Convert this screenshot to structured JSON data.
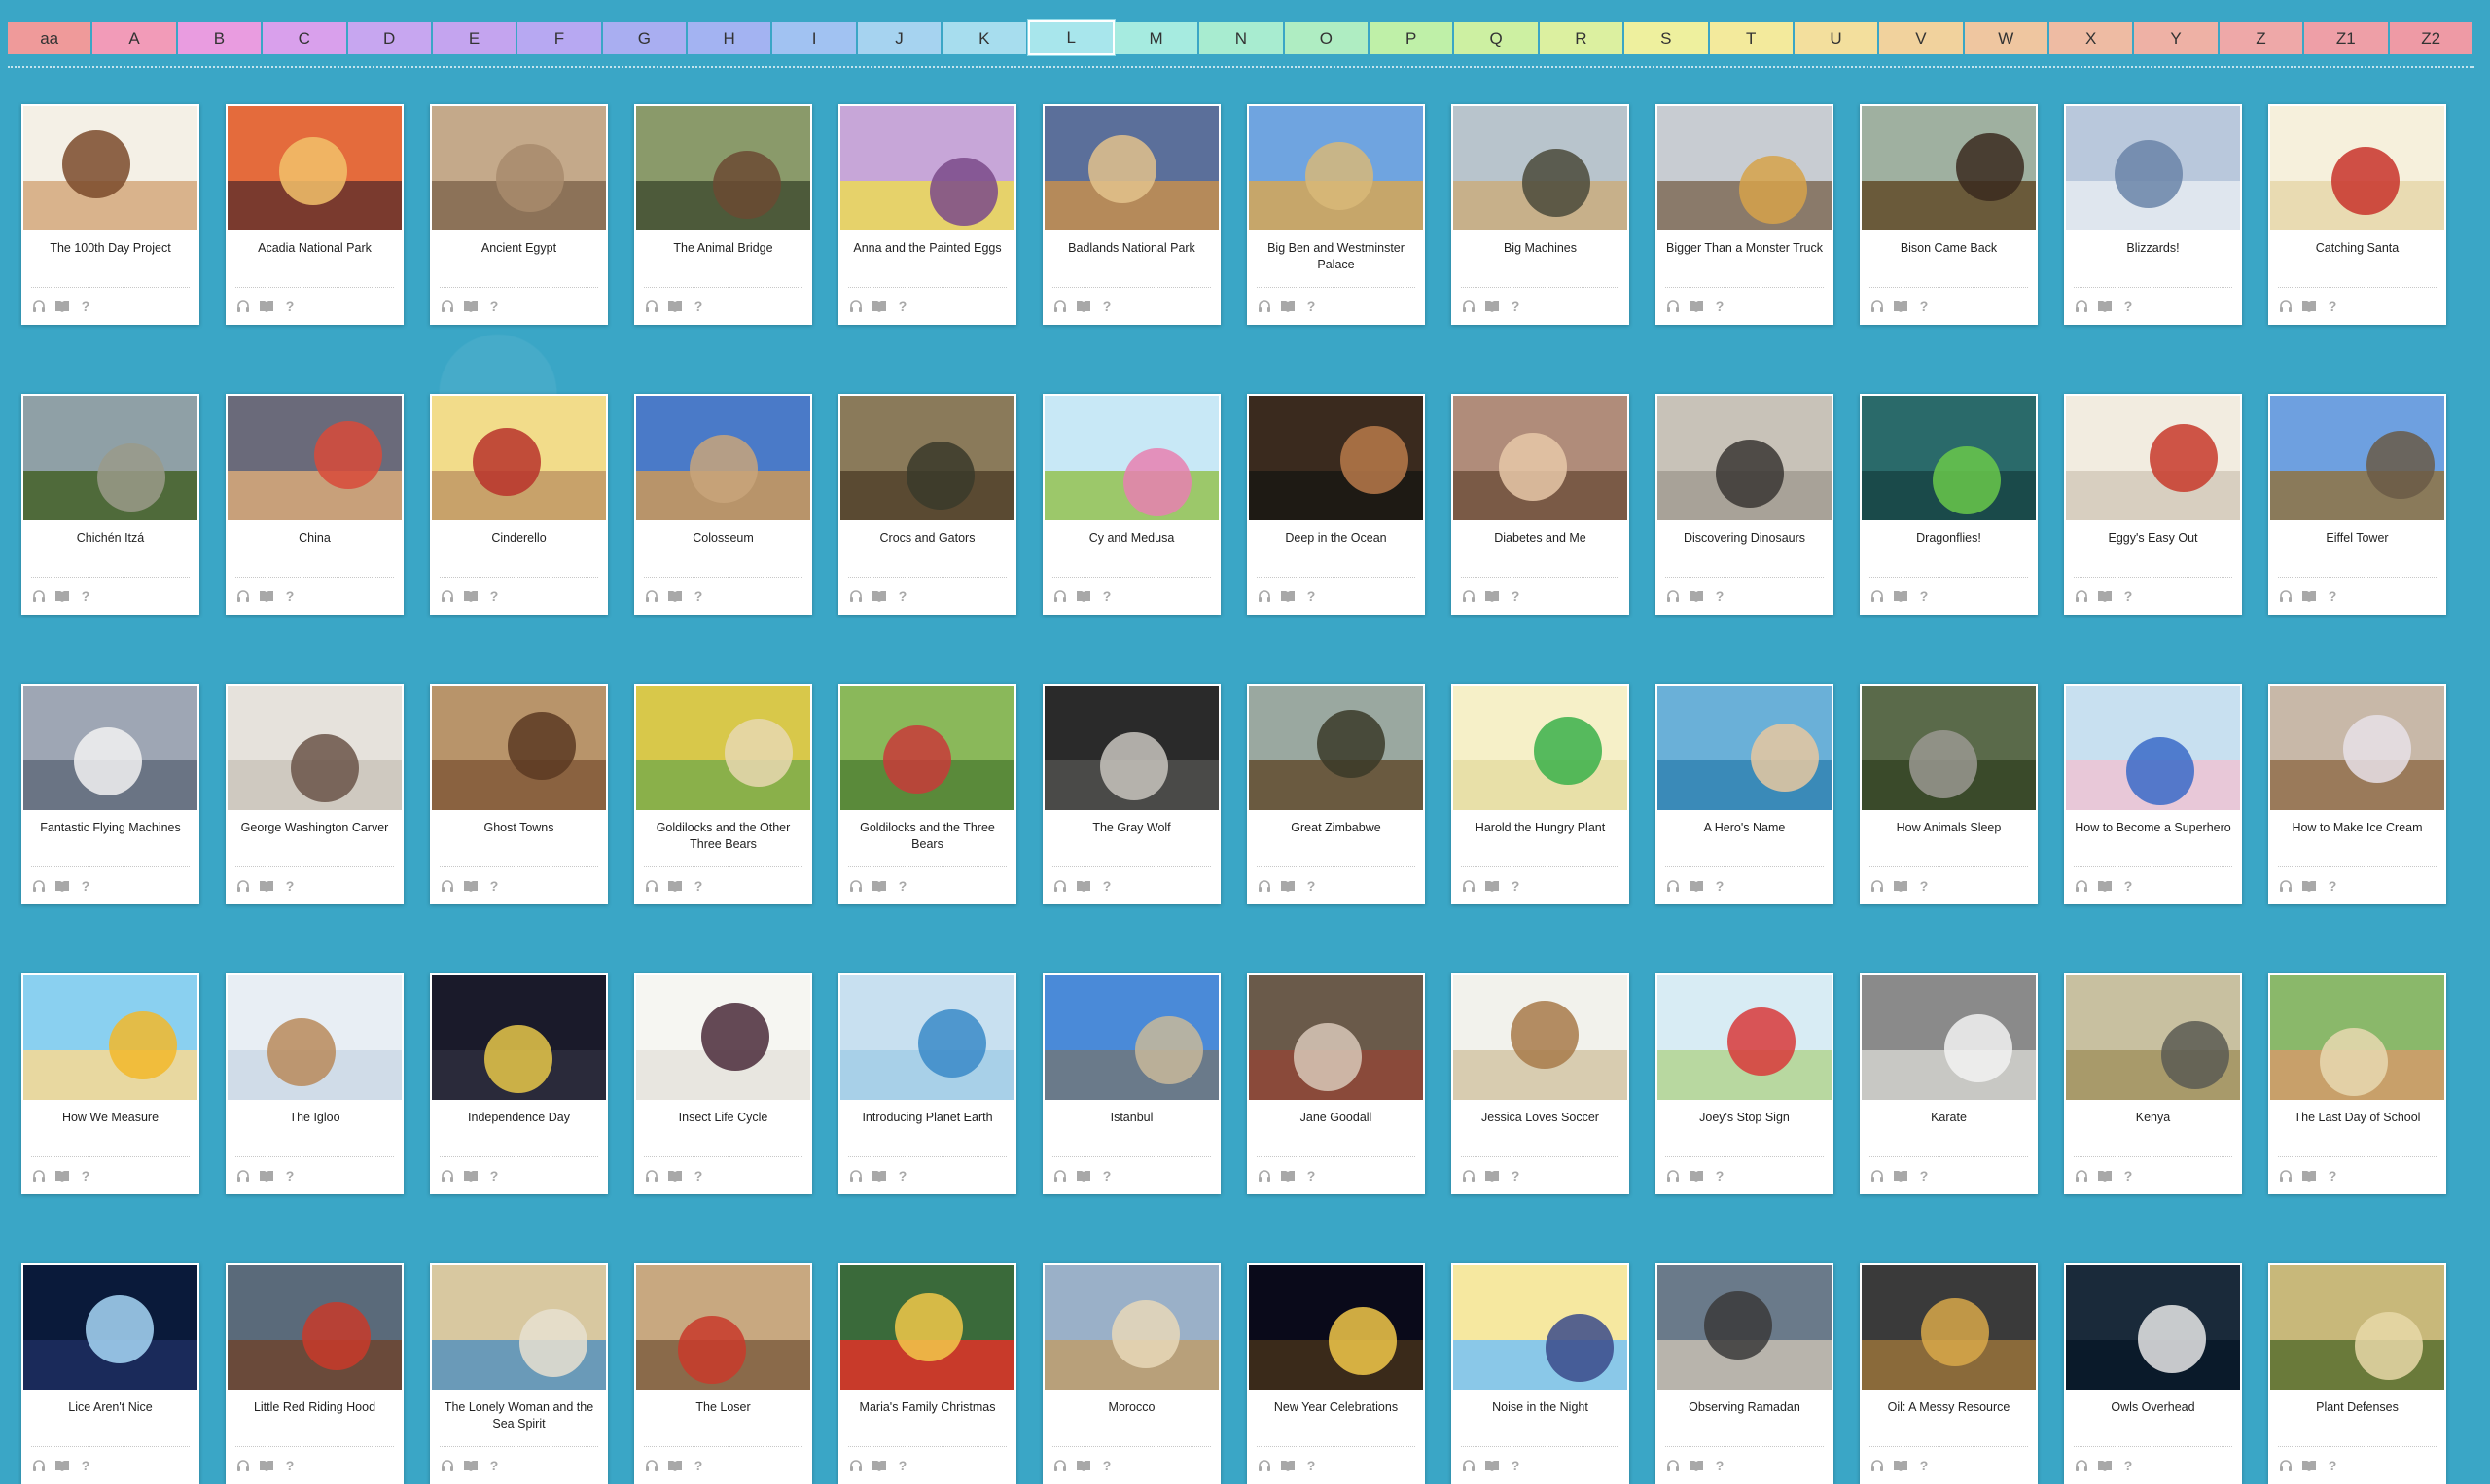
{
  "tabs": [
    {
      "label": "aa",
      "color": "#ef9a9a"
    },
    {
      "label": "A",
      "color": "#f29bb8"
    },
    {
      "label": "B",
      "color": "#e99ce0"
    },
    {
      "label": "C",
      "color": "#d9a0ec"
    },
    {
      "label": "D",
      "color": "#c7a6f0"
    },
    {
      "label": "E",
      "color": "#c4a4ef"
    },
    {
      "label": "F",
      "color": "#b7a8f2"
    },
    {
      "label": "G",
      "color": "#a9aef1"
    },
    {
      "label": "H",
      "color": "#a3b3f2"
    },
    {
      "label": "I",
      "color": "#a1c2f2"
    },
    {
      "label": "J",
      "color": "#a6d3f0"
    },
    {
      "label": "K",
      "color": "#a7ddee"
    },
    {
      "label": "L",
      "color": "#a8e6ec"
    },
    {
      "label": "M",
      "color": "#a6ebe0"
    },
    {
      "label": "N",
      "color": "#a8ecd0"
    },
    {
      "label": "O",
      "color": "#afedc2"
    },
    {
      "label": "P",
      "color": "#bff0a8"
    },
    {
      "label": "Q",
      "color": "#cdf0a2"
    },
    {
      "label": "R",
      "color": "#dcf0a0"
    },
    {
      "label": "S",
      "color": "#eef09e"
    },
    {
      "label": "T",
      "color": "#f3ea9c"
    },
    {
      "label": "U",
      "color": "#f3df9d"
    },
    {
      "label": "V",
      "color": "#f1d29d"
    },
    {
      "label": "W",
      "color": "#efc6a0"
    },
    {
      "label": "X",
      "color": "#eebba3"
    },
    {
      "label": "Y",
      "color": "#eeb1a5"
    },
    {
      "label": "Z",
      "color": "#eea8a8"
    },
    {
      "label": "Z1",
      "color": "#ee9fa7"
    },
    {
      "label": "Z2",
      "color": "#ee9aa5"
    }
  ],
  "active_tab": "L",
  "books": [
    {
      "title": "The 100th Day Project",
      "sky": "#f4f0e6",
      "ground": "#d9b38c",
      "a": "#7a4a2a"
    },
    {
      "title": "Acadia National Park",
      "sky": "#e46b3c",
      "ground": "#7a3a2e",
      "a": "#f2c16a"
    },
    {
      "title": "Ancient Egypt",
      "sky": "#c4a98a",
      "ground": "#8c7258",
      "a": "#a88b6c"
    },
    {
      "title": "The Animal Bridge",
      "sky": "#8a9a6a",
      "ground": "#4d5a3a",
      "a": "#6b4a32"
    },
    {
      "title": "Anna and the Painted Eggs",
      "sky": "#c7a6d8",
      "ground": "#e6d26a",
      "a": "#7a4a8a"
    },
    {
      "title": "Badlands National Park",
      "sky": "#5b6f9a",
      "ground": "#b58a5a",
      "a": "#e3c28c"
    },
    {
      "title": "Big Ben and Westminster Palace",
      "sky": "#6fa4e0",
      "ground": "#c6a66a",
      "a": "#d8b878"
    },
    {
      "title": "Big Machines",
      "sky": "#b8c4cc",
      "ground": "#c7b08a",
      "a": "#4a4a3a"
    },
    {
      "title": "Bigger Than a Monster Truck",
      "sky": "#c8ccd2",
      "ground": "#8a7a6a",
      "a": "#d6a24a"
    },
    {
      "title": "Bison Came Back",
      "sky": "#9fb0a0",
      "ground": "#6a5a3a",
      "a": "#3a2a1e"
    },
    {
      "title": "Blizzards!",
      "sky": "#b9c8dc",
      "ground": "#dfe6ee",
      "a": "#6a84a8"
    },
    {
      "title": "Catching Santa",
      "sky": "#f6f0dc",
      "ground": "#e9dbb2",
      "a": "#c8322a"
    },
    {
      "title": "Chichén Itzá",
      "sky": "#8fa0a6",
      "ground": "#4f6a3a",
      "a": "#9a9a8a"
    },
    {
      "title": "China",
      "sky": "#6a6a7a",
      "ground": "#c8a07a",
      "a": "#d84a3a"
    },
    {
      "title": "Cinderello",
      "sky": "#f2dc8a",
      "ground": "#c8a26a",
      "a": "#b8322a"
    },
    {
      "title": "Colosseum",
      "sky": "#4a7ac8",
      "ground": "#b8946a",
      "a": "#c8a47a"
    },
    {
      "title": "Crocs and Gators",
      "sky": "#8a7a5a",
      "ground": "#5a4a32",
      "a": "#3a3a2a"
    },
    {
      "title": "Cy and Medusa",
      "sky": "#c8e8f6",
      "ground": "#9cc86a",
      "a": "#e880b0"
    },
    {
      "title": "Deep in the Ocean",
      "sky": "#3a2a1e",
      "ground": "#1e1a14",
      "a": "#b87a4a"
    },
    {
      "title": "Diabetes and Me",
      "sky": "#b08c7a",
      "ground": "#7a5a46",
      "a": "#e8c8a8"
    },
    {
      "title": "Discovering Dinosaurs",
      "sky": "#c8c2b8",
      "ground": "#a8a298",
      "a": "#3a3632"
    },
    {
      "title": "Dragonflies!",
      "sky": "#2a6a6a",
      "ground": "#1a4a4a",
      "a": "#6ac84a"
    },
    {
      "title": "Eggy's Easy Out",
      "sky": "#f2ece0",
      "ground": "#d8cfc0",
      "a": "#c83a2a"
    },
    {
      "title": "Eiffel Tower",
      "sky": "#6ea0e0",
      "ground": "#8a7a5a",
      "a": "#6a5a46"
    },
    {
      "title": "Fantastic Flying Machines",
      "sky": "#9ea6b4",
      "ground": "#6a7484",
      "a": "#f2f2f2"
    },
    {
      "title": "George Washington Carver",
      "sky": "#e6e2dc",
      "ground": "#cfc9c0",
      "a": "#6a5448"
    },
    {
      "title": "Ghost Towns",
      "sky": "#b8946a",
      "ground": "#8a6240",
      "a": "#5a3a22"
    },
    {
      "title": "Goldilocks and the Other Three Bears",
      "sky": "#d8c84a",
      "ground": "#8ab04a",
      "a": "#e8d8b0"
    },
    {
      "title": "Goldilocks and the Three Bears",
      "sky": "#8ab85a",
      "ground": "#5a8a3a",
      "a": "#c83a3a"
    },
    {
      "title": "The Gray Wolf",
      "sky": "#2a2a2a",
      "ground": "#4a4a48",
      "a": "#c8c4be"
    },
    {
      "title": "Great Zimbabwe",
      "sky": "#9aa8a0",
      "ground": "#6a5a40",
      "a": "#3a3a28"
    },
    {
      "title": "Harold the Hungry Plant",
      "sky": "#f6f0c8",
      "ground": "#e8e0a8",
      "a": "#3ab04a"
    },
    {
      "title": "A Hero's Name",
      "sky": "#6ab0d8",
      "ground": "#3a8ab8",
      "a": "#e8c8a0"
    },
    {
      "title": "How Animals Sleep",
      "sky": "#5a6a4a",
      "ground": "#3a4a2a",
      "a": "#9a9890"
    },
    {
      "title": "How to Become a Superhero",
      "sky": "#c8e0f0",
      "ground": "#e8c8d8",
      "a": "#3a6ac8"
    },
    {
      "title": "How to Make Ice Cream",
      "sky": "#c8b8a8",
      "ground": "#9a7a5a",
      "a": "#e8e0e8"
    },
    {
      "title": "How We Measure",
      "sky": "#8ad0f0",
      "ground": "#e8d8a0",
      "a": "#f2b82a"
    },
    {
      "title": "The Igloo",
      "sky": "#e8eef4",
      "ground": "#d0dce8",
      "a": "#b88a5a"
    },
    {
      "title": "Independence Day",
      "sky": "#1a1a2a",
      "ground": "#2a2a3a",
      "a": "#e8c84a"
    },
    {
      "title": "Insect Life Cycle",
      "sky": "#f6f6f2",
      "ground": "#e8e6e0",
      "a": "#4a2a3a"
    },
    {
      "title": "Introducing Planet Earth",
      "sky": "#c8e0f0",
      "ground": "#a8d0e8",
      "a": "#3a8ac8"
    },
    {
      "title": "Istanbul",
      "sky": "#4a8ad8",
      "ground": "#6a7a8a",
      "a": "#c8b89a"
    },
    {
      "title": "Jane Goodall",
      "sky": "#6a5a4a",
      "ground": "#8a4a3a",
      "a": "#d8c8b8"
    },
    {
      "title": "Jessica Loves Soccer",
      "sky": "#f2f2ec",
      "ground": "#d8ccb0",
      "a": "#a87a4a"
    },
    {
      "title": "Joey's Stop Sign",
      "sky": "#d8ecf4",
      "ground": "#b8d8a0",
      "a": "#d83a3a"
    },
    {
      "title": "Karate",
      "sky": "#8a8a8a",
      "ground": "#c8c8c4",
      "a": "#f2f2f2"
    },
    {
      "title": "Kenya",
      "sky": "#c8c0a0",
      "ground": "#a89a6a",
      "a": "#5a5a52"
    },
    {
      "title": "The Last Day of School",
      "sky": "#8ab86a",
      "ground": "#c8a06a",
      "a": "#e8d8b0"
    },
    {
      "title": "Lice Aren't Nice",
      "sky": "#0a1a3a",
      "ground": "#1a2a5a",
      "a": "#a8d8f8"
    },
    {
      "title": "Little Red Riding Hood",
      "sky": "#5a6a7a",
      "ground": "#6a4a3a",
      "a": "#c83a2a"
    },
    {
      "title": "The Lonely Woman and the Sea Spirit",
      "sky": "#d8c8a0",
      "ground": "#6a9ab8",
      "a": "#e8e0d0"
    },
    {
      "title": "The Loser",
      "sky": "#c8a880",
      "ground": "#8a6a4a",
      "a": "#c83a2a"
    },
    {
      "title": "Maria's Family Christmas",
      "sky": "#3a6a3a",
      "ground": "#c83a2a",
      "a": "#f2c84a"
    },
    {
      "title": "Morocco",
      "sky": "#9ab0c8",
      "ground": "#b8a07a",
      "a": "#e8d8b8"
    },
    {
      "title": "New Year Celebrations",
      "sky": "#0a0a1a",
      "ground": "#3a2a1a",
      "a": "#f2c84a"
    },
    {
      "title": "Noise in the Night",
      "sky": "#f6e8a0",
      "ground": "#8ac8e8",
      "a": "#3a4a8a"
    },
    {
      "title": "Observing Ramadan",
      "sky": "#6a7a8a",
      "ground": "#b8b4ac",
      "a": "#3a3a3a"
    },
    {
      "title": "Oil: A Messy Resource",
      "sky": "#3a3a3a",
      "ground": "#8a6a3a",
      "a": "#d8a84a"
    },
    {
      "title": "Owls Overhead",
      "sky": "#1a2a3a",
      "ground": "#0a1a2a",
      "a": "#e8e8e8"
    },
    {
      "title": "Plant Defenses",
      "sky": "#c8b87a",
      "ground": "#6a7a3a",
      "a": "#e8d8a8"
    }
  ],
  "icons": {
    "audio": "headphones-icon",
    "read": "book-icon",
    "quiz": "question-icon"
  },
  "icon_color": "#a8a8a8"
}
